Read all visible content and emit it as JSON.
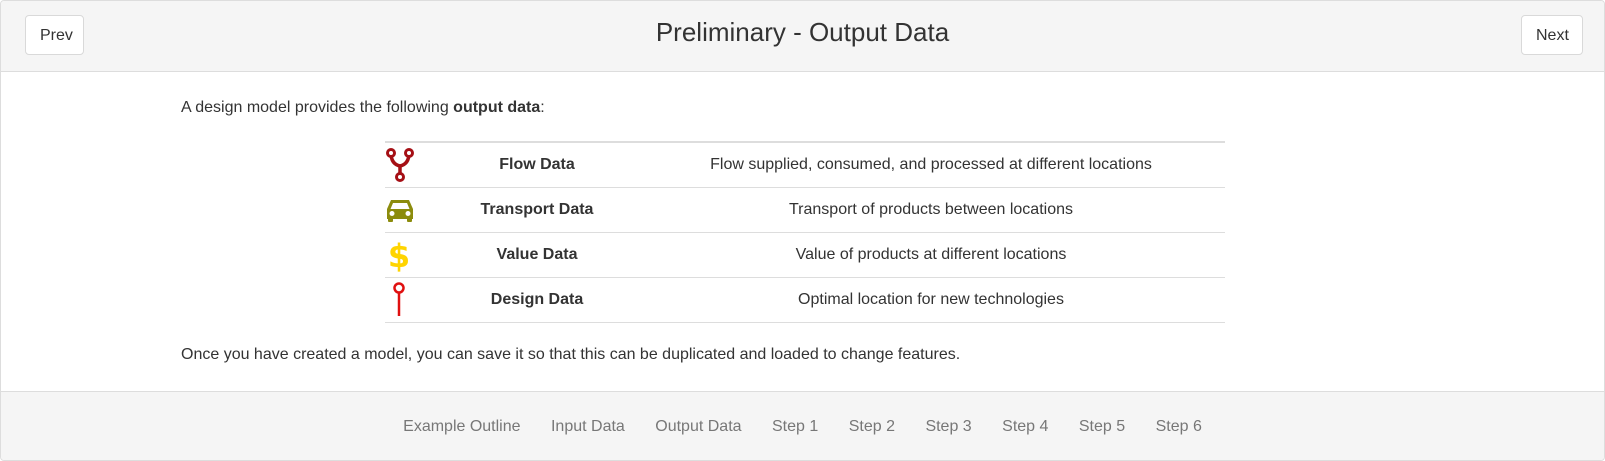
{
  "header": {
    "prev_label": "Prev",
    "next_label": "Next",
    "title": "Preliminary - Output Data"
  },
  "content": {
    "intro_prefix": "A design model provides the following ",
    "intro_bold": "output data",
    "intro_suffix": ":",
    "rows": [
      {
        "icon": "flow-fork-icon",
        "color": "#a50f15",
        "name": "Flow Data",
        "description": "Flow supplied, consumed, and processed at different locations"
      },
      {
        "icon": "car-icon",
        "color": "#8c8c0d",
        "name": "Transport Data",
        "description": "Transport of products between locations"
      },
      {
        "icon": "dollar-icon",
        "color": "#ffd400",
        "name": "Value Data",
        "description": "Value of products at different locations"
      },
      {
        "icon": "map-pin-icon",
        "color": "#e01010",
        "name": "Design Data",
        "description": "Optimal location for new technologies"
      }
    ],
    "outro": "Once you have created a model, you can save it so that this can be duplicated and loaded to change features."
  },
  "footer": {
    "nav": [
      "Example Outline",
      "Input Data",
      "Output Data",
      "Step 1",
      "Step 2",
      "Step 3",
      "Step 4",
      "Step 5",
      "Step 6"
    ]
  }
}
